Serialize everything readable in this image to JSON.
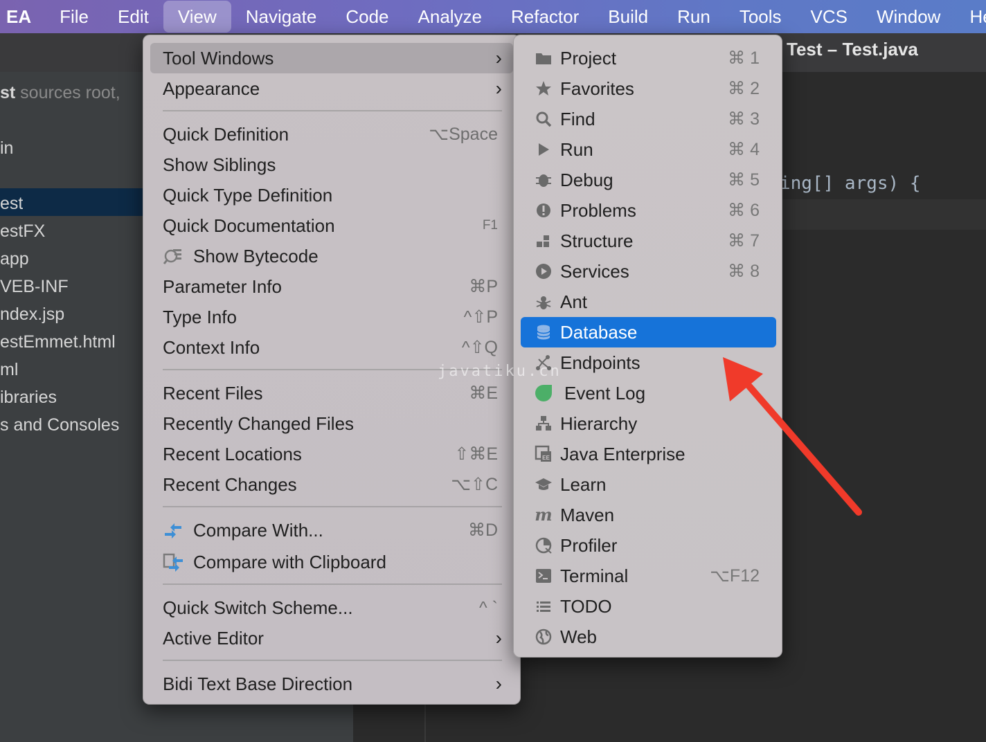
{
  "menubar": {
    "items": [
      "EA",
      "File",
      "Edit",
      "View",
      "Navigate",
      "Code",
      "Analyze",
      "Refactor",
      "Build",
      "Run",
      "Tools",
      "VCS",
      "Window",
      "He"
    ],
    "active_index": 3
  },
  "editor": {
    "title": "Test – Test.java",
    "code_line": "ing[] args) {"
  },
  "project_tree": {
    "header_bold": "st",
    "header_rest": " sources root,",
    "items": [
      "in",
      "est",
      "estFX",
      "app",
      "VEB-INF",
      "ndex.jsp",
      "estEmmet.html",
      "ml",
      "ibraries",
      "s and Consoles"
    ],
    "selected": "est"
  },
  "view_menu": {
    "items": [
      {
        "label": "Tool Windows",
        "submenu": true
      },
      {
        "label": "Appearance",
        "submenu": true
      },
      {
        "label": "Quick Definition",
        "shortcut": "⌥Space"
      },
      {
        "label": "Show Siblings",
        "shortcut": ""
      },
      {
        "label": "Quick Type Definition",
        "shortcut": ""
      },
      {
        "label": "Quick Documentation",
        "shortcut": "F1"
      },
      {
        "label": "Show Bytecode",
        "shortcut": "",
        "icon": "bytecode-icon"
      },
      {
        "label": "Parameter Info",
        "shortcut": "⌘P"
      },
      {
        "label": "Type Info",
        "shortcut": "^⇧P"
      },
      {
        "label": "Context Info",
        "shortcut": "^⇧Q"
      },
      {
        "label": "Recent Files",
        "shortcut": "⌘E"
      },
      {
        "label": "Recently Changed Files",
        "shortcut": ""
      },
      {
        "label": "Recent Locations",
        "shortcut": "⇧⌘E"
      },
      {
        "label": "Recent Changes",
        "shortcut": "⌥⇧C"
      },
      {
        "label": "Compare With...",
        "shortcut": "⌘D",
        "icon": "compare-icon"
      },
      {
        "label": "Compare with Clipboard",
        "shortcut": "",
        "icon": "compare-clipboard-icon"
      },
      {
        "label": "Quick Switch Scheme...",
        "shortcut": "^ `"
      },
      {
        "label": "Active Editor",
        "submenu": true
      },
      {
        "label": "Bidi Text Base Direction",
        "submenu": true
      }
    ]
  },
  "tool_windows_menu": {
    "items": [
      {
        "label": "Project",
        "shortcut": "⌘ 1",
        "icon": "folder-icon"
      },
      {
        "label": "Favorites",
        "shortcut": "⌘ 2",
        "icon": "star-icon"
      },
      {
        "label": "Find",
        "shortcut": "⌘ 3",
        "icon": "search-icon"
      },
      {
        "label": "Run",
        "shortcut": "⌘ 4",
        "icon": "play-icon"
      },
      {
        "label": "Debug",
        "shortcut": "⌘ 5",
        "icon": "bug-icon"
      },
      {
        "label": "Problems",
        "shortcut": "⌘ 6",
        "icon": "problems-icon"
      },
      {
        "label": "Structure",
        "shortcut": "⌘ 7",
        "icon": "structure-icon"
      },
      {
        "label": "Services",
        "shortcut": "⌘ 8",
        "icon": "services-icon"
      },
      {
        "label": "Ant",
        "shortcut": "",
        "icon": "ant-icon"
      },
      {
        "label": "Database",
        "shortcut": "",
        "icon": "database-icon"
      },
      {
        "label": "Endpoints",
        "shortcut": "",
        "icon": "endpoints-icon"
      },
      {
        "label": "Event Log",
        "shortcut": "",
        "icon": "event-log-icon"
      },
      {
        "label": "Hierarchy",
        "shortcut": "",
        "icon": "hierarchy-icon"
      },
      {
        "label": "Java Enterprise",
        "shortcut": "",
        "icon": "java-enterprise-icon"
      },
      {
        "label": "Learn",
        "shortcut": "",
        "icon": "learn-icon"
      },
      {
        "label": "Maven",
        "shortcut": "",
        "icon": "maven-icon"
      },
      {
        "label": "Profiler",
        "shortcut": "",
        "icon": "profiler-icon"
      },
      {
        "label": "Terminal",
        "shortcut": "⌥F12",
        "icon": "terminal-icon"
      },
      {
        "label": "TODO",
        "shortcut": "",
        "icon": "todo-icon"
      },
      {
        "label": "Web",
        "shortcut": "",
        "icon": "web-icon"
      }
    ],
    "selected": "Database",
    "selection_color": "#1673d9"
  },
  "watermark": "javatiku.cn",
  "annotation_arrow_color": "#f03a2a"
}
